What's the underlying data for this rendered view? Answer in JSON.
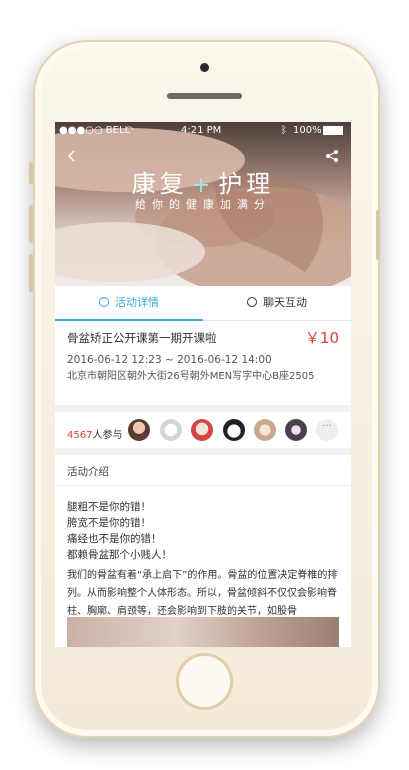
{
  "status_bar": {
    "carrier": "●●●○○ BELL",
    "time": "4:21 PM",
    "battery": "100%"
  },
  "hero": {
    "title_left": "康复",
    "title_plus": "+",
    "title_right": "护理",
    "subtitle": "给你的健康加满分"
  },
  "tabs": [
    {
      "label": "活动详情",
      "active": true
    },
    {
      "label": "聊天互动",
      "active": false
    }
  ],
  "event": {
    "title": "骨盆矫正公开课第一期开课啦",
    "price": "￥10",
    "datetime": "2016-06-12  12:23 ~ 2016-06-12  14:00",
    "address": "北京市朝阳区朝外大街26号朝外MEN写字中心B座2505"
  },
  "participants": {
    "count": "4567",
    "suffix": "人参与",
    "more": "···"
  },
  "intro": {
    "heading": "活动介绍",
    "lines": [
      "腿粗不是你的错！",
      "胯宽不是你的错！",
      "痛经也不是你的错！",
      "都赖骨盆那个小贱人！"
    ],
    "paragraph": "我们的骨盆有着“承上启下”的作用。骨盆的位置决定脊椎的排列。从而影响整个人体形态。所以，骨盆倾斜不仅仅会影响脊柱、胸廓、肩颈等，还会影响到下肢的关节，如股骨"
  },
  "colors": {
    "accent": "#3aa7e0",
    "price": "#e23c3c"
  }
}
